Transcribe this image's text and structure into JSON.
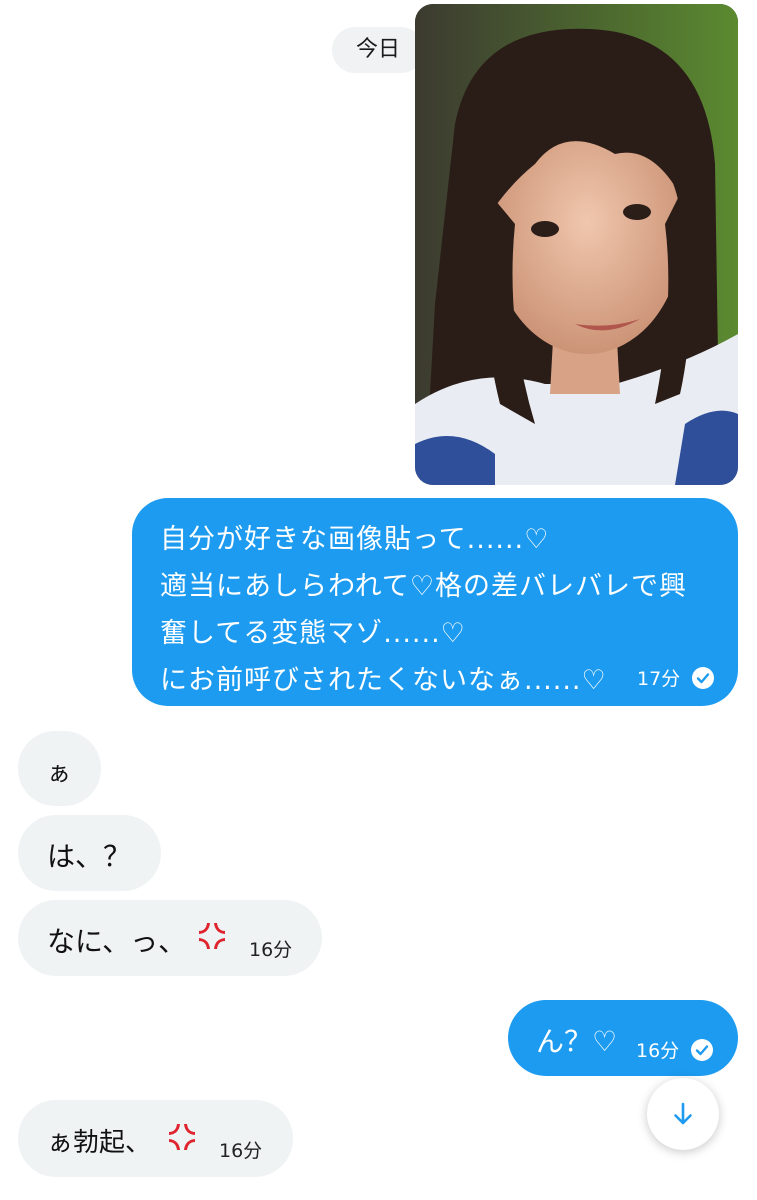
{
  "date_separator": "今日",
  "colors": {
    "outgoing_bubble": "#1d9bf0",
    "incoming_bubble": "#eff3f4",
    "accent": "#1d9bf0"
  },
  "messages": [
    {
      "direction": "outgoing",
      "kind": "image",
      "image_description_icon": "photo"
    },
    {
      "direction": "outgoing",
      "lines": [
        "自分が好きな画像貼って......♡",
        "適当にあしらわれて♡格の差バレバレで興",
        "奮してる変態マゾ......♡",
        "にお前呼びされたくないなぁ......♡"
      ],
      "time": "17分",
      "read_icon": "check-circle-icon"
    },
    {
      "direction": "incoming",
      "text": "ぁ"
    },
    {
      "direction": "incoming",
      "text": "は、？"
    },
    {
      "direction": "incoming",
      "text": "なに、っ、",
      "emoji": "anger-symbol-icon",
      "time": "16分"
    },
    {
      "direction": "outgoing",
      "text": "ん？♡",
      "time": "16分",
      "read_icon": "check-circle-icon"
    },
    {
      "direction": "incoming",
      "text": "ぁ勃起、",
      "emoji": "anger-symbol-icon",
      "time": "16分"
    }
  ],
  "scroll_button_icon": "arrow-down-icon"
}
